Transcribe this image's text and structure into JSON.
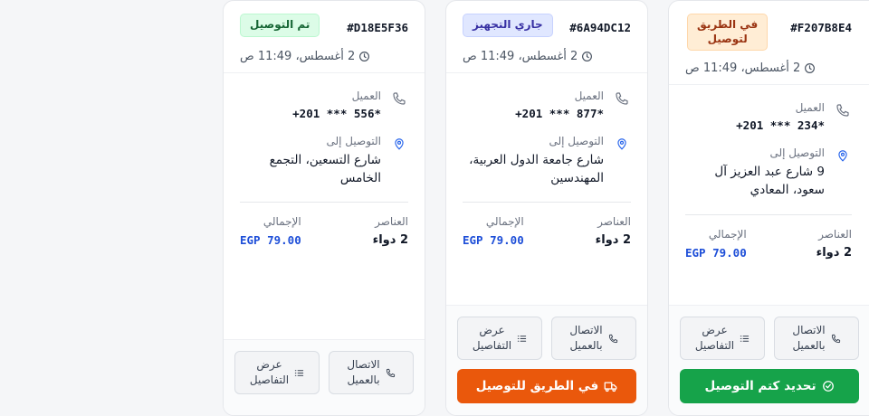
{
  "labels": {
    "customer": "العميل",
    "deliver_to": "التوصيل إلى",
    "items": "العناصر",
    "total": "الإجمالي",
    "call_customer_line1": "الاتصال",
    "call_customer_line2": "بالعميل",
    "view_details_line1": "عرض",
    "view_details_line2": "التفاصيل"
  },
  "orders": [
    {
      "id": "#D18E5F36",
      "status": "تم التوصيل",
      "status_color": "#166534",
      "time": "2 أغسطس، 11:49 ص",
      "phone": "+201 *** 556*",
      "address": "شارع التسعين، التجمع الخامس",
      "items": "2 دواء",
      "total": "EGP 79.00"
    },
    {
      "id": "#6A94DC12",
      "status": "جاري التجهيز",
      "status_color": "#3730a3",
      "time": "2 أغسطس، 11:49 ص",
      "phone": "+201 *** 877*",
      "address": "شارع جامعة الدول العربية، المهندسين",
      "items": "2 دواء",
      "total": "EGP 79.00",
      "action": "في الطريق للتوصيل",
      "action_color": "#ea580c"
    },
    {
      "id": "#F207B8E4",
      "status_line1": "في الطريق",
      "status_line2": "لتوصيل",
      "status_color": "#9a3412",
      "time": "2 أغسطس، 11:49 ص",
      "phone": "+201 *** 234*",
      "address": "9 شارع عبد العزيز آل سعود، المعادي",
      "items": "2 دواء",
      "total": "EGP 79.00",
      "action": "تحديد كتم التوصيل",
      "action_color": "#16a34a"
    }
  ]
}
